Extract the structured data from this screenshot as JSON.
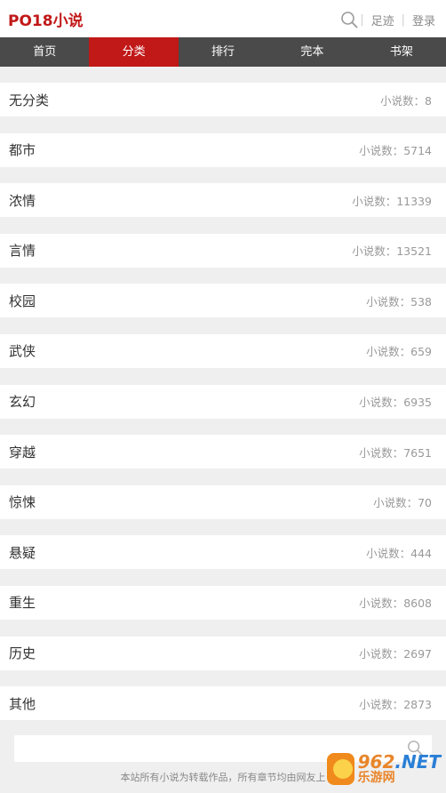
{
  "header": {
    "logo": "PO18小说",
    "footprint_label": "足迹",
    "login_label": "登录",
    "separator": "|"
  },
  "nav": [
    {
      "label": "首页",
      "active": false
    },
    {
      "label": "分类",
      "active": true
    },
    {
      "label": "排行",
      "active": false
    },
    {
      "label": "完本",
      "active": false
    },
    {
      "label": "书架",
      "active": false
    }
  ],
  "categories": [
    {
      "name": "无分类",
      "count_label": "小说数：",
      "count": "8"
    },
    {
      "name": "都市",
      "count_label": "小说数：",
      "count": "5714"
    },
    {
      "name": "浓情",
      "count_label": "小说数：",
      "count": "11339"
    },
    {
      "name": "言情",
      "count_label": "小说数：",
      "count": "13521"
    },
    {
      "name": "校园",
      "count_label": "小说数：",
      "count": "538"
    },
    {
      "name": "武侠",
      "count_label": "小说数：",
      "count": "659"
    },
    {
      "name": "玄幻",
      "count_label": "小说数：",
      "count": "6935"
    },
    {
      "name": "穿越",
      "count_label": "小说数：",
      "count": "7651"
    },
    {
      "name": "惊悚",
      "count_label": "小说数：",
      "count": "70"
    },
    {
      "name": "悬疑",
      "count_label": "小说数：",
      "count": "444"
    },
    {
      "name": "重生",
      "count_label": "小说数：",
      "count": "8608"
    },
    {
      "name": "历史",
      "count_label": "小说数：",
      "count": "2697"
    },
    {
      "name": "其他",
      "count_label": "小说数：",
      "count": "2873"
    }
  ],
  "footer": {
    "search_placeholder": "",
    "note": "本站所有小说为转载作品，所有章节均由网友上"
  },
  "watermark": {
    "big": "962",
    "dot_text": ".NET",
    "small": "乐游网"
  },
  "colors": {
    "brand": "#c11818",
    "nav_bg": "#4a4a4a",
    "page_bg": "#efefef"
  }
}
